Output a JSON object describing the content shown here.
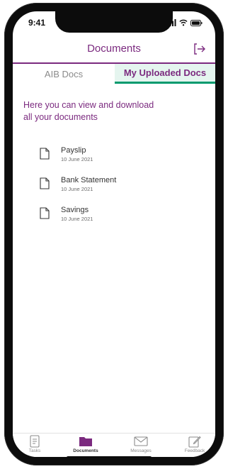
{
  "status_bar": {
    "time": "9:41"
  },
  "header": {
    "title": "Documents"
  },
  "tabs": [
    {
      "label": "AIB Docs",
      "active": false
    },
    {
      "label": "My Uploaded Docs",
      "active": true
    }
  ],
  "intro_text": "Here you can view and download all your documents",
  "documents": [
    {
      "name": "Payslip",
      "date": "10 June 2021"
    },
    {
      "name": "Bank Statement",
      "date": "10 June 2021"
    },
    {
      "name": "Savings",
      "date": "10 June 2021"
    }
  ],
  "bottom_nav": [
    {
      "label": "Tasks",
      "icon": "tasks-icon",
      "active": false
    },
    {
      "label": "Documents",
      "icon": "folder-icon",
      "active": true
    },
    {
      "label": "Messages",
      "icon": "envelope-icon",
      "active": false
    },
    {
      "label": "Feedback",
      "icon": "edit-icon",
      "active": false
    }
  ],
  "colors": {
    "brand_purple": "#7b2a7f",
    "active_tab_underline": "#009a6e",
    "active_tab_background": "#e5f5ef"
  }
}
